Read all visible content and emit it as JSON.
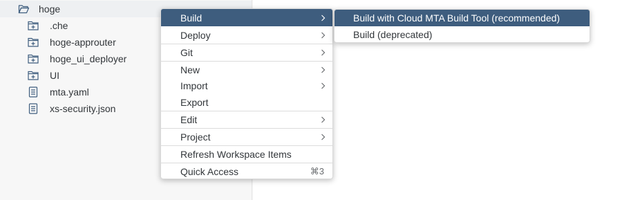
{
  "tree": {
    "root": {
      "label": "hoge",
      "icon": "folder-open-icon"
    },
    "items": [
      {
        "label": ".che",
        "icon": "folder-icon"
      },
      {
        "label": "hoge-approuter",
        "icon": "folder-icon"
      },
      {
        "label": "hoge_ui_deployer",
        "icon": "folder-icon"
      },
      {
        "label": "UI",
        "icon": "folder-icon"
      },
      {
        "label": "mta.yaml",
        "icon": "document-icon"
      },
      {
        "label": "xs-security.json",
        "icon": "document-icon"
      }
    ]
  },
  "context_menu": {
    "items": [
      {
        "label": "Build",
        "has_submenu": true,
        "active": true
      },
      {
        "label": "Deploy",
        "has_submenu": true
      },
      {
        "label": "Git",
        "has_submenu": true
      },
      {
        "label": "New",
        "has_submenu": true
      },
      {
        "label": "Import",
        "has_submenu": true
      },
      {
        "label": "Export",
        "has_submenu": false
      },
      {
        "label": "Edit",
        "has_submenu": true
      },
      {
        "label": "Project",
        "has_submenu": true
      },
      {
        "label": "Refresh Workspace Items",
        "has_submenu": false
      },
      {
        "label": "Quick Access",
        "has_submenu": false,
        "shortcut": "⌘3"
      }
    ]
  },
  "build_submenu": {
    "items": [
      {
        "label": "Build with Cloud MTA Build Tool (recommended)",
        "active": true
      },
      {
        "label": "Build (deprecated)"
      }
    ]
  },
  "colors": {
    "accent": "#3e5d7e",
    "icon": "#3e5d7e"
  }
}
